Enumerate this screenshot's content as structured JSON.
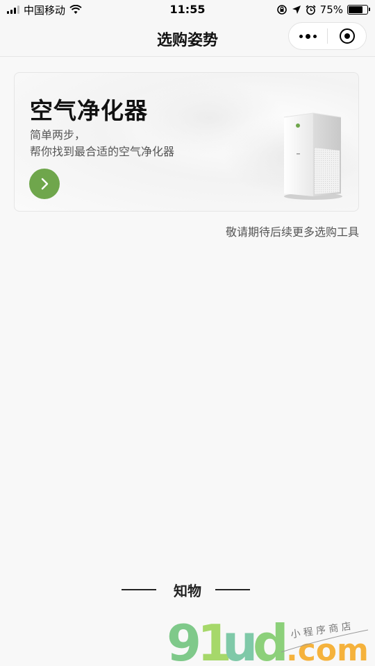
{
  "status_bar": {
    "carrier": "中国移动",
    "time": "11:55",
    "battery_pct": "75%",
    "battery_level": 0.75,
    "icons": [
      "signal-icon",
      "wifi-icon",
      "rotation-lock-icon",
      "location-icon",
      "alarm-icon",
      "battery-icon"
    ]
  },
  "nav": {
    "title": "选购姿势",
    "more_icon": "more-dots-icon",
    "close_icon": "close-ring-icon"
  },
  "card": {
    "title": "空气净化器",
    "subtitle_line1": "简单两步，",
    "subtitle_line2": "帮你找到最合适的空气净化器",
    "go_icon": "chevron-right-icon",
    "button_color": "#6fa64c",
    "product_image": "air-purifier"
  },
  "coming_soon": "敬请期待后续更多选购工具",
  "footer": {
    "brand": "知物"
  },
  "watermark": {
    "text": "91ud.com",
    "tagline": "小程序商店"
  },
  "colors": {
    "accent_green": "#6fa64c",
    "background": "#f8f8f8"
  }
}
